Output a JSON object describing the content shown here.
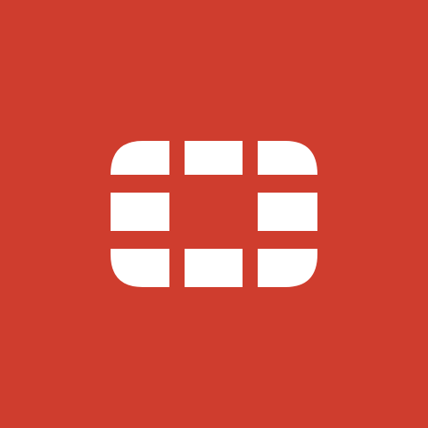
{
  "app": {
    "name": "",
    "icon": "fortinet-logo-icon"
  },
  "colors": {
    "background": "#cf3d2e",
    "logo": "#ffffff"
  }
}
